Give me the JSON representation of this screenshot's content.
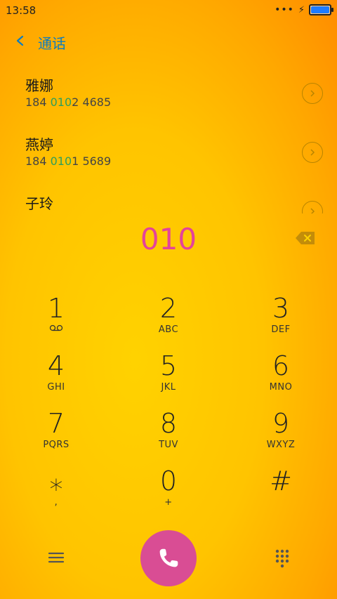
{
  "status_bar": {
    "time": "13:58",
    "more_icon": "more-dots-icon",
    "charging_icon": "bolt-icon",
    "battery_icon": "battery-icon"
  },
  "header": {
    "title": "通话",
    "back_icon": "chevron-left-icon"
  },
  "contacts": [
    {
      "name": "雅娜",
      "number_prefix": "184 ",
      "number_match": "010",
      "number_suffix": "2 4685"
    },
    {
      "name": "燕婷",
      "number_prefix": "184 ",
      "number_match": "010",
      "number_suffix": "1 5689"
    },
    {
      "name": "子玲"
    }
  ],
  "dialed_number": "010",
  "keypad": [
    {
      "digit": "1",
      "letters": ""
    },
    {
      "digit": "2",
      "letters": "ABC"
    },
    {
      "digit": "3",
      "letters": "DEF"
    },
    {
      "digit": "4",
      "letters": "GHI"
    },
    {
      "digit": "5",
      "letters": "JKL"
    },
    {
      "digit": "6",
      "letters": "MNO"
    },
    {
      "digit": "7",
      "letters": "PQRS"
    },
    {
      "digit": "8",
      "letters": "TUV"
    },
    {
      "digit": "9",
      "letters": "WXYZ"
    },
    {
      "digit": "⁎",
      "letters": ","
    },
    {
      "digit": "0",
      "letters": "+"
    },
    {
      "digit": "#",
      "letters": ""
    }
  ],
  "colors": {
    "accent_blue": "#0b7cc2",
    "dialed_pink": "#e4439a",
    "match_green": "#2e9e5a",
    "call_button": "#d94d94"
  }
}
